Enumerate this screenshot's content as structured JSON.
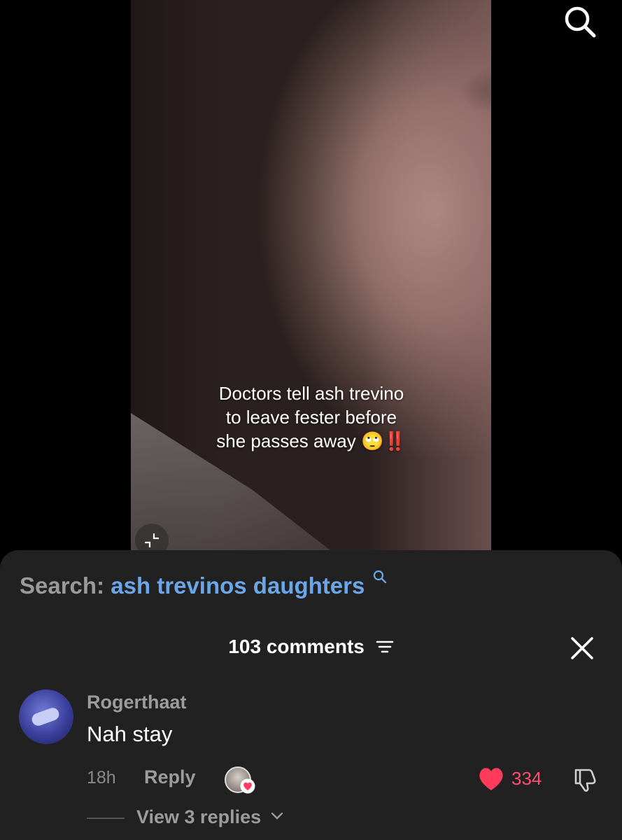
{
  "video": {
    "caption_lines": [
      "Doctors tell ash trevino",
      "to leave fester before",
      "she passes away 🙄‼️"
    ]
  },
  "search_bar": {
    "prefix": "Search:",
    "query": "ash trevinos daughters"
  },
  "comments": {
    "count_label": "103 comments",
    "items": [
      {
        "username": "Rogerthaat",
        "text": "Nah stay",
        "time": "18h",
        "reply_label": "Reply",
        "likes": "334",
        "view_replies_label": "View 3 replies"
      }
    ]
  },
  "colors": {
    "accent_link": "#6ba6e8",
    "like_red": "#ff4d6d",
    "sheet_bg": "#212121"
  }
}
